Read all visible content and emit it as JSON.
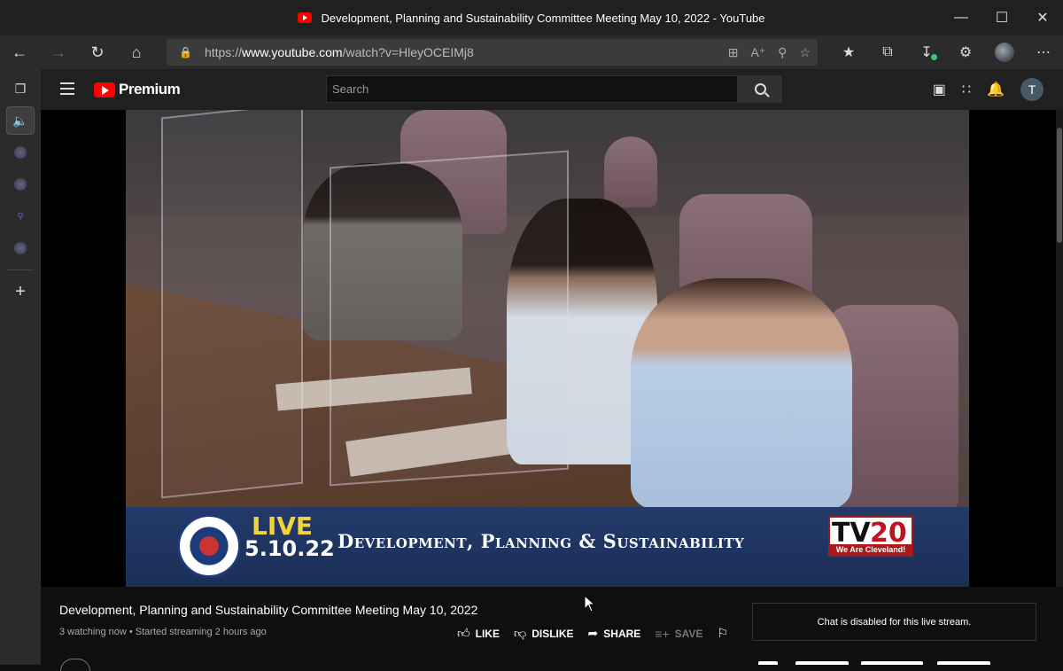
{
  "window": {
    "title": "Development, Planning and Sustainability Committee Meeting May 10, 2022 - YouTube",
    "controls": [
      "minimize",
      "maximize",
      "close"
    ]
  },
  "browser": {
    "url_prefix": "https://",
    "url_domain": "www.youtube.com",
    "url_path": "/watch?v=HleyOCEIMj8"
  },
  "youtube": {
    "logo_text": "Premium",
    "search_placeholder": "Search",
    "avatar_initial": "T"
  },
  "video": {
    "banner_live": "LIVE",
    "banner_date": "5.10.22",
    "banner_title": "Development, Planning & Sustainability",
    "tv_label": "TV",
    "tv_number": "20",
    "tv_tagline": "We Are Cleveland!"
  },
  "details": {
    "title": "Development, Planning and Sustainability Committee Meeting May 10, 2022",
    "meta": "3 watching now • Started streaming 2 hours ago",
    "actions": {
      "like": "LIKE",
      "dislike": "DISLIKE",
      "share": "SHARE",
      "save": "SAVE"
    },
    "chat_message": "Chat is disabled for this live stream."
  }
}
